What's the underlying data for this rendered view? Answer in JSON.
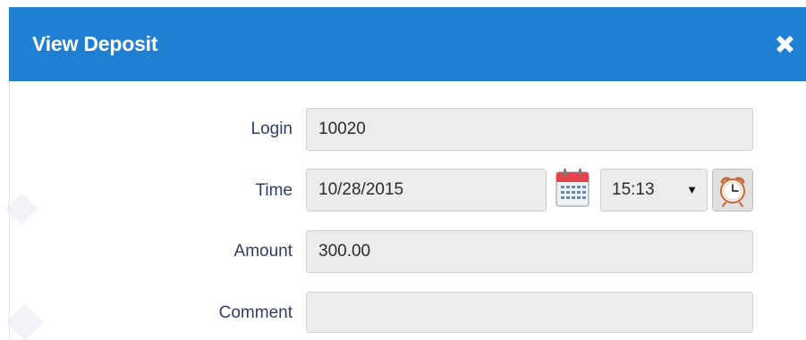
{
  "dialog": {
    "title": "View Deposit",
    "close_icon": "close-icon",
    "accent_color": "#1f7fd1"
  },
  "form": {
    "login": {
      "label": "Login",
      "value": "10020"
    },
    "time": {
      "label": "Time",
      "date_value": "10/28/2015",
      "time_value": "15:13",
      "calendar_icon": "calendar-icon",
      "clock_icon": "alarm-clock-icon"
    },
    "amount": {
      "label": "Amount",
      "value": "300.00"
    },
    "comment": {
      "label": "Comment",
      "value": ""
    }
  }
}
